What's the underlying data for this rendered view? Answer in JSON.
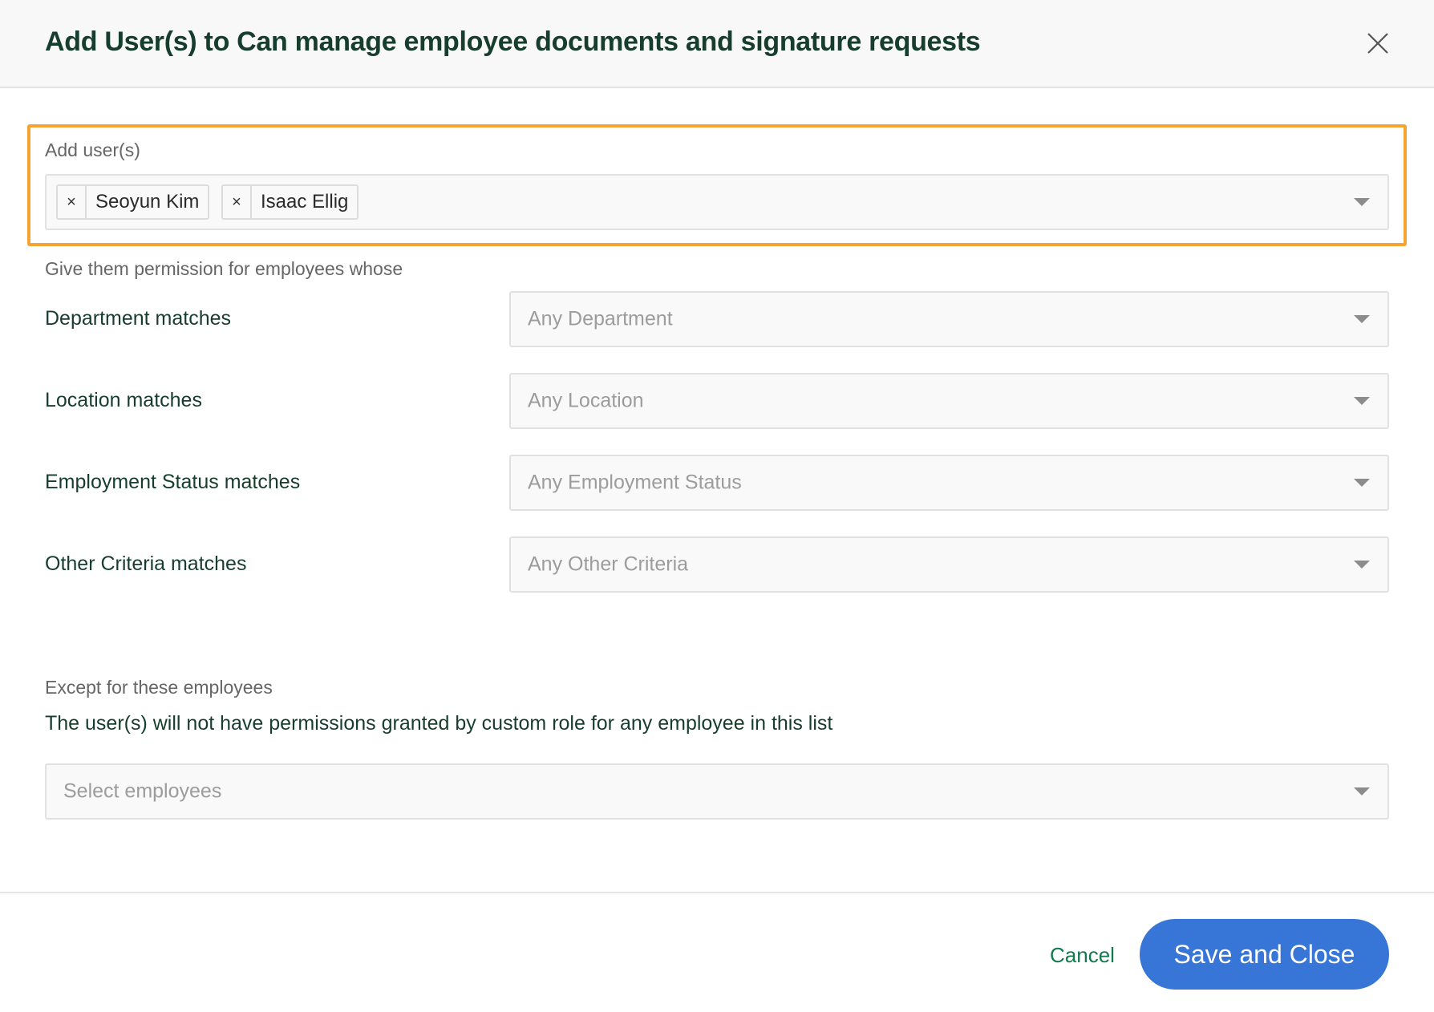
{
  "dialog": {
    "title": "Add User(s) to Can manage employee documents and signature requests",
    "close_icon": "close-icon"
  },
  "add_users": {
    "label": "Add user(s)",
    "selected": [
      {
        "name": "Seoyun Kim",
        "remove_icon": "×"
      },
      {
        "name": "Isaac Ellig",
        "remove_icon": "×"
      }
    ],
    "highlight_color": "#f5a431"
  },
  "permissions": {
    "intro": "Give them permission for employees whose",
    "rows": [
      {
        "label": "Department matches",
        "placeholder": "Any Department"
      },
      {
        "label": "Location matches",
        "placeholder": "Any Location"
      },
      {
        "label": "Employment Status matches",
        "placeholder": "Any Employment Status"
      },
      {
        "label": "Other Criteria matches",
        "placeholder": "Any Other Criteria"
      }
    ]
  },
  "exceptions": {
    "heading": "Except for these employees",
    "description": "The user(s) will not have permissions granted by custom role for any employee in this list",
    "placeholder": "Select employees"
  },
  "footer": {
    "cancel_label": "Cancel",
    "save_label": "Save and Close",
    "primary_color": "#3776d6",
    "cancel_color": "#127a4e"
  }
}
